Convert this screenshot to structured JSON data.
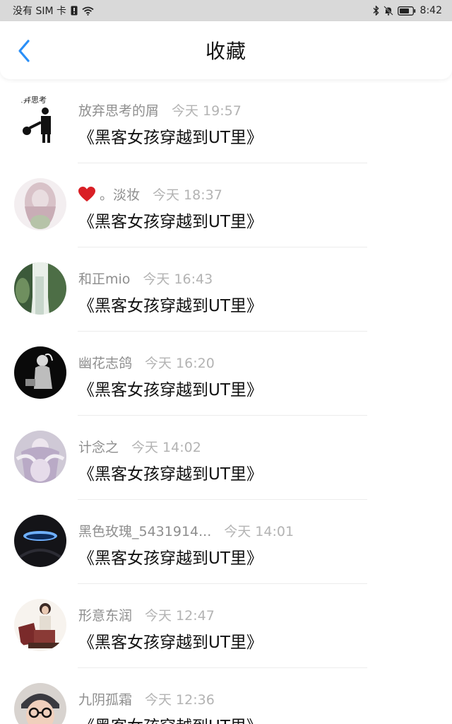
{
  "status_bar": {
    "carrier": "没有 SIM 卡",
    "time": "8:42"
  },
  "header": {
    "title": "收藏"
  },
  "favorites": [
    {
      "name": "放弃思考的屑",
      "time": "今天 19:57",
      "content": "《黑客女孩穿越到UT里》",
      "avatar": "stick-figure-icon"
    },
    {
      "name": "。淡妆",
      "time": "今天 18:37",
      "content": "《黑客女孩穿越到UT里》",
      "avatar": "pink-hair-girl",
      "has_heart": true
    },
    {
      "name": "和正mio",
      "time": "今天 16:43",
      "content": "《黑客女孩穿越到UT里》",
      "avatar": "waterfall-landscape"
    },
    {
      "name": "幽花志鸽",
      "time": "今天 16:20",
      "content": "《黑客女孩穿越到UT里》",
      "avatar": "dark-portrait"
    },
    {
      "name": "计念之",
      "time": "今天 14:02",
      "content": "《黑客女孩穿越到UT里》",
      "avatar": "fantasy-figure"
    },
    {
      "name": "黑色玫瑰_5431914...",
      "time": "今天 14:01",
      "content": "《黑客女孩穿越到UT里》",
      "avatar": "dark-eye"
    },
    {
      "name": "形意东润",
      "time": "今天 12:47",
      "content": "《黑客女孩穿越到UT里》",
      "avatar": "seated-figure"
    },
    {
      "name": "九阴孤霜",
      "time": "今天 12:36",
      "content": "《黑客女孩穿越到UT里》",
      "avatar": "glasses-child"
    }
  ],
  "colors": {
    "accent": "#2a8ff7",
    "status_bar_bg": "#d9d9d9",
    "name_text": "#8e8e8e",
    "time_text": "#b3b3b3",
    "heart": "#d91f26"
  }
}
